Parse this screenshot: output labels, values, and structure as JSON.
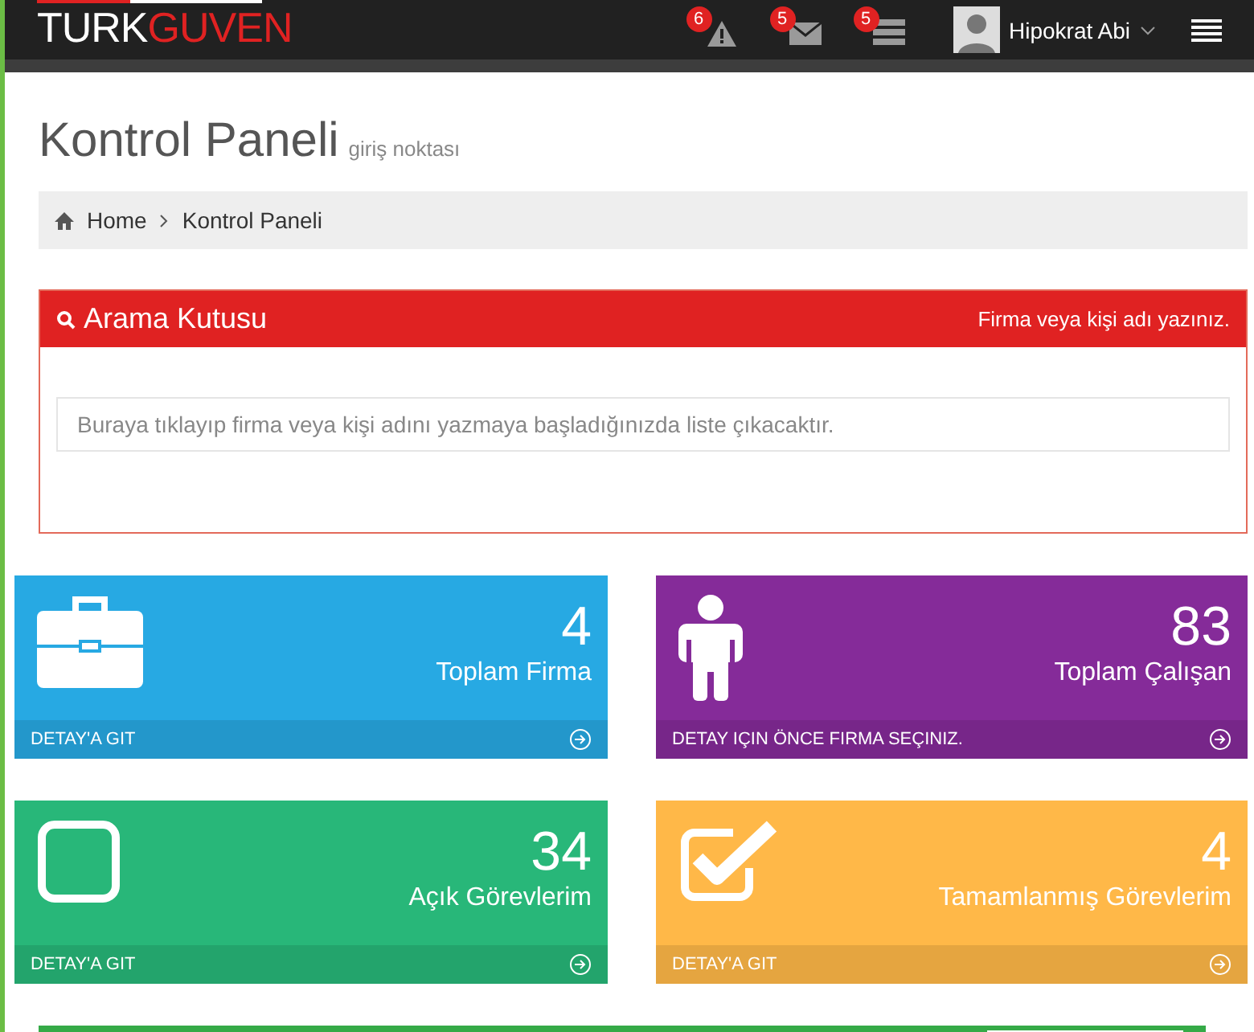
{
  "header": {
    "logo": {
      "first": "TURK",
      "second": "GUVEN"
    },
    "notifications": [
      {
        "kind": "warning",
        "count": "6"
      },
      {
        "kind": "mail",
        "count": "5"
      },
      {
        "kind": "tasks",
        "count": "5"
      }
    ],
    "user": {
      "name": "Hipokrat Abi"
    }
  },
  "page": {
    "title": "Kontrol Paneli",
    "subtitle": "giriş noktası"
  },
  "breadcrumb": [
    "Home",
    "Kontrol Paneli"
  ],
  "search": {
    "title": "Arama Kutusu",
    "hint": "Firma veya kişi adı yazınız.",
    "placeholder": "Buraya tıklayıp firma veya kişi adını yazmaya başladığınızda liste çıkacaktır."
  },
  "stats": [
    {
      "kind": "briefcase",
      "color": "#27a9e3",
      "number": "4",
      "label": "Toplam Firma",
      "link": "DETAY'A GIT"
    },
    {
      "kind": "person",
      "color": "#852b99",
      "number": "83",
      "label": "Toplam Çalışan",
      "link": "DETAY IÇIN ÖNCE FIRMA SEÇINIZ."
    },
    {
      "kind": "square",
      "color": "#28b779",
      "number": "34",
      "label": "Açık Görevlerim",
      "link": "DETAY'A GIT"
    },
    {
      "kind": "check",
      "color": "#ffb848",
      "number": "4",
      "label": "Tamamlanmış Görevlerim",
      "link": "DETAY'A GIT"
    }
  ]
}
